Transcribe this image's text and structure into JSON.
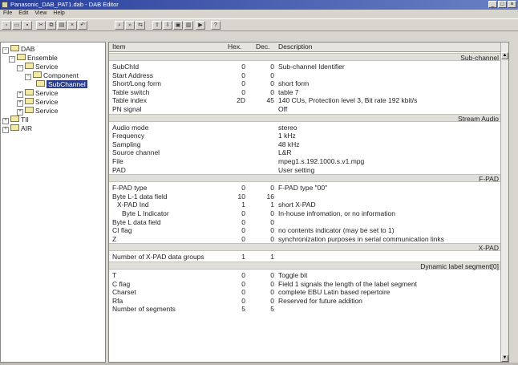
{
  "window": {
    "title": "Panasonic_DAB_PAT1.dab - DAB Editor",
    "controls": [
      "_",
      "□",
      "×"
    ]
  },
  "menu": [
    "File",
    "Edit",
    "View",
    "Help"
  ],
  "toolbar": {
    "buttons": [
      "new-icon",
      "open-icon",
      "save-icon",
      "cut-icon",
      "copy-icon",
      "paste-icon",
      "delete-icon",
      "undo-icon",
      "find-icon",
      "find-next-icon",
      "replace-icon",
      "export-icon",
      "import-icon",
      "send-icon",
      "tool-icon",
      "play-icon",
      "help-icon"
    ]
  },
  "tree": [
    {
      "label": "DAB",
      "exp": "−"
    },
    {
      "label": "Ensemble",
      "exp": "−"
    },
    {
      "label": "Service",
      "exp": "−"
    },
    {
      "label": "Component",
      "exp": "−"
    },
    {
      "label": "SubChannel",
      "exp": ""
    },
    {
      "label": "Service",
      "exp": "+"
    },
    {
      "label": "Service",
      "exp": "+"
    },
    {
      "label": "Service",
      "exp": "+"
    },
    {
      "label": "TII",
      "exp": "+"
    },
    {
      "label": "AIR",
      "exp": "+"
    }
  ],
  "table": {
    "headers": {
      "item": "Item",
      "hex": "Hex.",
      "dec": "Dec.",
      "desc": "Description"
    },
    "rows": [
      {
        "type": "section",
        "title": "Sub-channel"
      },
      {
        "item": "SubChId",
        "hex": "0",
        "dec": "0",
        "desc": "Sub-channel Identifier"
      },
      {
        "item": "Start Address",
        "hex": "0",
        "dec": "0",
        "desc": ""
      },
      {
        "item": "Short/Long form",
        "hex": "0",
        "dec": "0",
        "desc": "short form"
      },
      {
        "item": "Table switch",
        "hex": "0",
        "dec": "0",
        "desc": "table 7"
      },
      {
        "item": "Table index",
        "hex": "2D",
        "dec": "45",
        "desc": "140 CUs, Protection level 3, Bit rate 192 kbit/s"
      },
      {
        "item": "PN signal",
        "hex": "",
        "dec": "",
        "desc": "Off"
      },
      {
        "type": "section",
        "title": "Stream Audio"
      },
      {
        "item": "Audio mode",
        "hex": "",
        "dec": "",
        "desc": "stereo"
      },
      {
        "item": "Frequency",
        "hex": "",
        "dec": "",
        "desc": "1 kHz"
      },
      {
        "item": "Sampling",
        "hex": "",
        "dec": "",
        "desc": "48 kHz"
      },
      {
        "item": "Source channel",
        "hex": "",
        "dec": "",
        "desc": "L&R"
      },
      {
        "item": "File",
        "hex": "",
        "dec": "",
        "desc": "mpeg1.s.192.1000.s.v1.mpg"
      },
      {
        "item": "PAD",
        "hex": "",
        "dec": "",
        "desc": "User setting"
      },
      {
        "type": "section",
        "title": "F-PAD"
      },
      {
        "item": "F-PAD type",
        "hex": "0",
        "dec": "0",
        "desc": "F-PAD type \"00\""
      },
      {
        "item": "Byte L-1 data field",
        "hex": "10",
        "dec": "16",
        "desc": ""
      },
      {
        "item": "X-PAD Ind",
        "hex": "1",
        "dec": "1",
        "desc": "short X-PAD",
        "indent": 1
      },
      {
        "item": "Byte L Indicator",
        "hex": "0",
        "dec": "0",
        "desc": "In-house infromation, or no information",
        "indent": 2
      },
      {
        "item": "Byte L data field",
        "hex": "0",
        "dec": "0",
        "desc": ""
      },
      {
        "item": "CI flag",
        "hex": "0",
        "dec": "0",
        "desc": "no contents indicator (may be set to 1)"
      },
      {
        "item": "Z",
        "hex": "0",
        "dec": "0",
        "desc": "synchronization purposes in serial communication links"
      },
      {
        "type": "section",
        "title": "X-PAD"
      },
      {
        "item": "Number of X-PAD data groups",
        "hex": "1",
        "dec": "1",
        "desc": ""
      },
      {
        "type": "section",
        "title": "Dynamic label segment[0]"
      },
      {
        "item": "T",
        "hex": "0",
        "dec": "0",
        "desc": "Toggle bit"
      },
      {
        "item": "C flag",
        "hex": "0",
        "dec": "0",
        "desc": "Field 1 signals the length of the label segment"
      },
      {
        "item": "Charset",
        "hex": "0",
        "dec": "0",
        "desc": "complete EBU Latin based repertoire"
      },
      {
        "item": "Rfa",
        "hex": "0",
        "dec": "0",
        "desc": "Reserved for future addition"
      },
      {
        "item": "Number of segments",
        "hex": "5",
        "dec": "5",
        "desc": ""
      }
    ]
  },
  "colors": {
    "titlebar": "#283f9c",
    "selection": "#2b3d86",
    "section": "#e1dfda"
  }
}
